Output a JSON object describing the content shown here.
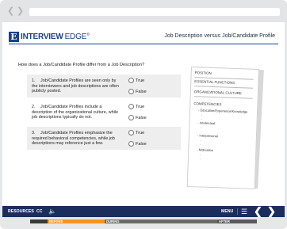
{
  "browser": {
    "back_icon": "back-chevron",
    "forward_icon": "forward-chevron"
  },
  "logo": {
    "mark": "E",
    "name_bold": "INTERVIEW",
    "name_light": "EDGE°"
  },
  "lesson_title": "Job Description versus Job/Candidate Profile",
  "question": "How does a Job/Candidate Profile differ from a Job Description?",
  "items": [
    {
      "num": "1.",
      "text": "Job/Candidate Profiles are seen only by the interviewers and job descriptions are often publicly posted.",
      "true_label": "True",
      "false_label": "False"
    },
    {
      "num": "2.",
      "text": "Job/Candidate Profiles include a description of the organizational culture, while job descriptions typically do not.",
      "true_label": "True",
      "false_label": "False"
    },
    {
      "num": "3.",
      "text": "Job/Candidate Profiles emphasize the required behavioral competencies, while job descriptions may reference just a few.",
      "true_label": "True",
      "false_label": "False"
    }
  ],
  "profile_sheet": {
    "position": "POSITION",
    "essential_functions": "ESSENTIAL FUNCTIONS",
    "organizational_culture": "ORGANIZATIONAL CULTURE",
    "competencies": "COMPETENCIES",
    "competency_items": [
      "- Education/Experience/Knowledge",
      "- Intellectual",
      "- Interpersonal",
      "- Motivation"
    ]
  },
  "toolbar": {
    "resources": "RESOURCES",
    "cc": "CC",
    "menu": "MENU",
    "colors": {
      "bar": "#1b2d5c",
      "accent": "#f7941d"
    }
  },
  "progress": {
    "before": "BEFORE",
    "during": "DURING",
    "after": "AFTER",
    "current_stage": "BEFORE"
  }
}
